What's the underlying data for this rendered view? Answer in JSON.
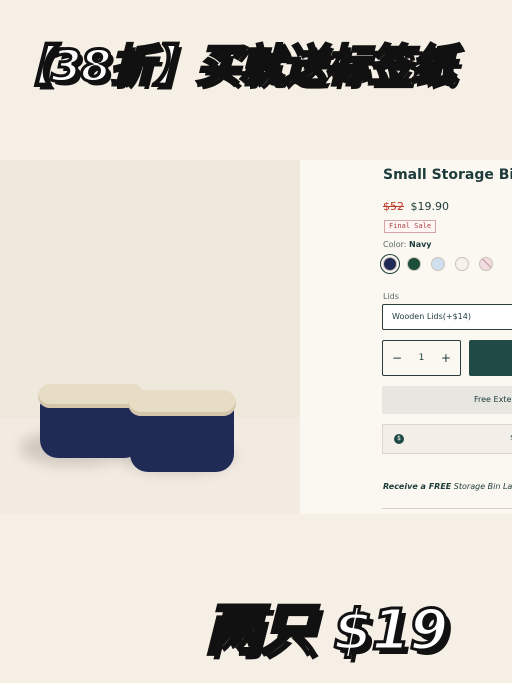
{
  "banner": {
    "top_text": "【38折】买就送标签纸",
    "bottom_text": "两只 $19"
  },
  "product": {
    "title": "Small Storage Bins",
    "old_price": "$52",
    "new_price": "$19.90",
    "sale_badge": "Final Sale",
    "color_label": "Color:",
    "color_value": "Navy",
    "swatches": [
      {
        "name": "Navy",
        "color": "#1f2a55",
        "selected": true
      },
      {
        "name": "Green",
        "color": "#1d4e3a"
      },
      {
        "name": "Light Blue",
        "color": "#cfdff0"
      },
      {
        "name": "White",
        "color": "#f7f3ec"
      },
      {
        "name": "Pink",
        "color": "#f3dcdf",
        "sold_out": true
      }
    ],
    "lids_label": "Lids",
    "lids_value": "Wooden Lids(+$14)",
    "quantity": "1",
    "qty_minus": "−",
    "qty_plus": "+",
    "shipping_text": "Free Exten",
    "info_icon": "$",
    "info_end": "$",
    "promo_bold": "Receive a FREE",
    "promo_rest": " Storage Bin Lab",
    "next_arrow": "→"
  }
}
